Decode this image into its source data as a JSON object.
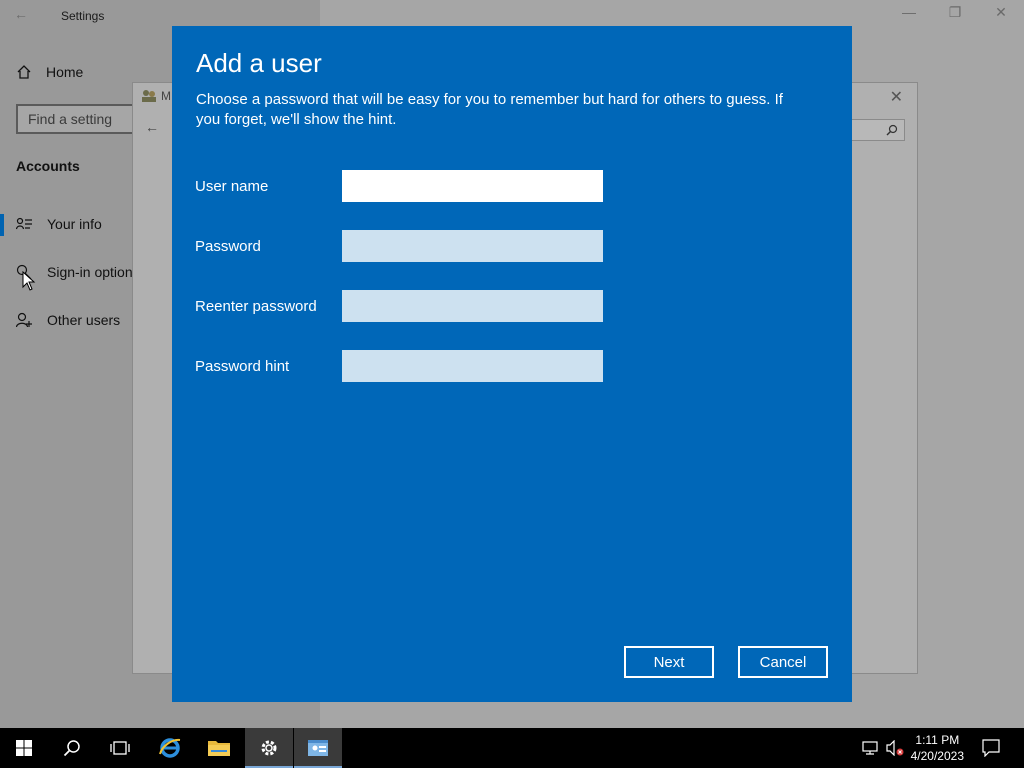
{
  "settings": {
    "title": "Settings",
    "nav": {
      "home": "Home",
      "search_placeholder": "Find a setting",
      "section": "Accounts",
      "items": [
        {
          "label": "Your info",
          "icon": "person-card-icon"
        },
        {
          "label": "Sign-in option",
          "icon": "key-icon"
        },
        {
          "label": "Other users",
          "icon": "add-person-icon"
        }
      ]
    }
  },
  "background_window": {
    "title": "M"
  },
  "dialog": {
    "title": "Add a user",
    "description": "Choose a password that will be easy for you to remember but hard for others to guess. If you forget, we'll show the hint.",
    "fields": [
      {
        "label": "User name",
        "value": ""
      },
      {
        "label": "Password",
        "value": ""
      },
      {
        "label": "Reenter password",
        "value": ""
      },
      {
        "label": "Password hint",
        "value": ""
      }
    ],
    "next_label": "Next",
    "cancel_label": "Cancel"
  },
  "taskbar": {
    "time": "1:11 PM",
    "date": "4/20/2023"
  },
  "colors": {
    "dialog_bg": "#0067b8",
    "accent": "#0063b1"
  }
}
